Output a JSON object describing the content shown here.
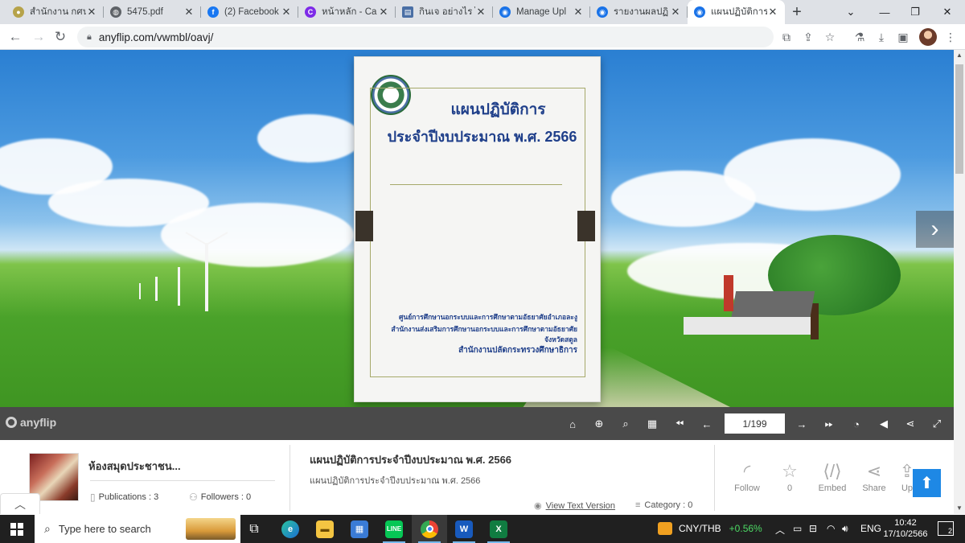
{
  "browser": {
    "tabs": [
      {
        "title": "สำนักงาน กศน.",
        "icon": "seal-icon",
        "color": "#b6a34a"
      },
      {
        "title": "5475.pdf",
        "icon": "globe-icon",
        "color": "#5f6368"
      },
      {
        "title": "(2) Facebook",
        "icon": "facebook-icon",
        "color": "#1877f2"
      },
      {
        "title": "หน้าหลัก - Ca",
        "icon": "canva-icon",
        "color": "#7d2ae8"
      },
      {
        "title": "กินเจ อย่างไร ไ",
        "icon": "printer-icon",
        "color": "#4a6fa5"
      },
      {
        "title": "Manage Upl",
        "icon": "anyflip-icon",
        "color": "#1a73e8"
      },
      {
        "title": "รายงานผลปฏิ",
        "icon": "anyflip-icon",
        "color": "#1a73e8"
      },
      {
        "title": "แผนปฏิบัติการ",
        "icon": "anyflip-icon",
        "color": "#1a73e8"
      }
    ],
    "url": "anyflip.com/vwmbl/oavj/"
  },
  "book": {
    "title_line1": "แผนปฏิบัติการ",
    "title_line2": "ประจำปีงบประมาณ พ.ศ. 2566",
    "footer_line1": "ศูนย์การศึกษานอกระบบและการศึกษาตามอัธยาศัยอำเภอละงู",
    "footer_line2": "สำนักงานส่งเสริมการศึกษานอกระบบและการศึกษาตามอัธยาศัย",
    "footer_line3": "จังหวัดสตูล",
    "footer_line4": "สำนักงานปลัดกระทรวงศึกษาธิการ"
  },
  "viewer": {
    "brand": "anyflip",
    "page_indicator": "1/199"
  },
  "info": {
    "library_name": "ห้องสมุดประชาชน...",
    "publications": "Publications : 3",
    "followers": "Followers : 0",
    "doc_title": "แผนปฏิบัติการประจำปีงบประมาณ พ.ศ. 2566",
    "doc_subtitle": "แผนปฏิบัติการประจำปีงบประมาณ พ.ศ. 2566",
    "view_text": "View Text Version",
    "category": "Category : 0",
    "actions": {
      "follow": "Follow",
      "likes": "0",
      "embed": "Embed",
      "share": "Share",
      "upload": "Up"
    }
  },
  "taskbar": {
    "search_placeholder": "Type here to search",
    "ticker_pair": "CNY/THB",
    "ticker_change": "+0.56%",
    "lang": "ENG",
    "time": "10:42",
    "date": "17/10/2566",
    "notif_count": "2"
  },
  "colors": {
    "accent": "#1e88e5",
    "book_text": "#1f3f8a",
    "toolbar_bg": "#4a4a4a"
  }
}
